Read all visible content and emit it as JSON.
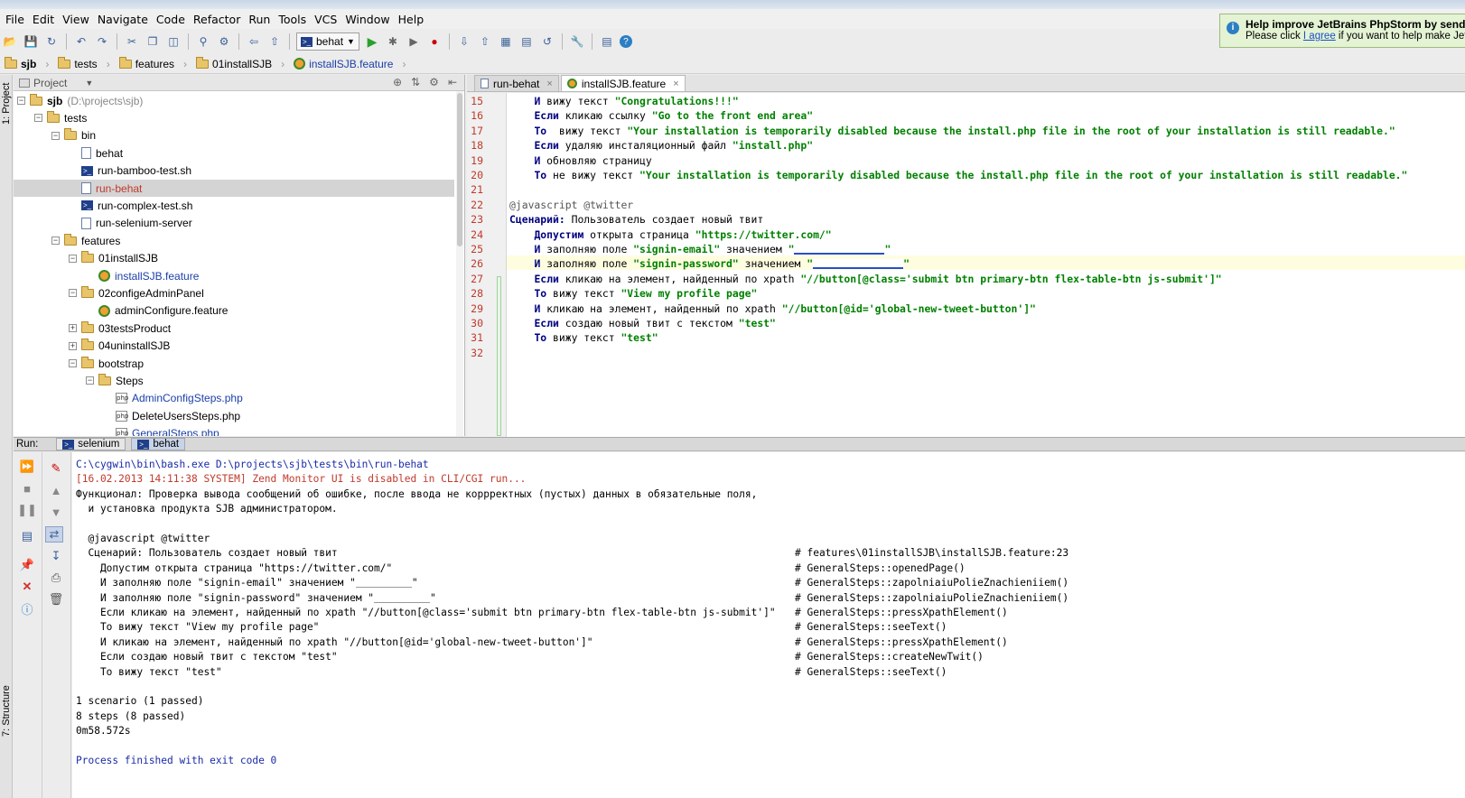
{
  "menu": [
    "File",
    "Edit",
    "View",
    "Navigate",
    "Code",
    "Refactor",
    "Run",
    "Tools",
    "VCS",
    "Window",
    "Help"
  ],
  "toolbar": {
    "run_config": "behat",
    "icons": [
      "open-icon",
      "save-icon",
      "sync-icon",
      "undo-icon",
      "redo-icon",
      "cut-icon",
      "copy-icon",
      "paste-icon",
      "find-icon",
      "replace-icon",
      "back-icon",
      "forward-icon",
      "run-icon",
      "debug-icon",
      "coverage-icon",
      "stop-icon",
      "settings-icon",
      "help-icon"
    ]
  },
  "notification": {
    "title": "Help improve JetBrains PhpStorm by sendin",
    "body_prefix": "Please click ",
    "link": "I agree",
    "body_suffix": " if you want to help make JetBra"
  },
  "breadcrumbs": [
    "sjb",
    "tests",
    "features",
    "01installSJB",
    "installSJB.feature"
  ],
  "left_strip": {
    "project": "1: Project",
    "structure": "7: Structure"
  },
  "project_panel": {
    "title": "Project",
    "tree": [
      {
        "label": "sjb",
        "extra": "(D:\\projects\\sjb)",
        "type": "folder",
        "depth": 0
      },
      {
        "label": "tests",
        "type": "folder",
        "depth": 1
      },
      {
        "label": "bin",
        "type": "folder",
        "depth": 2
      },
      {
        "label": "behat",
        "type": "file",
        "depth": 3
      },
      {
        "label": "run-bamboo-test.sh",
        "type": "sh",
        "depth": 3
      },
      {
        "label": "run-behat",
        "type": "file",
        "depth": 3,
        "selected": true
      },
      {
        "label": "run-complex-test.sh",
        "type": "sh",
        "depth": 3
      },
      {
        "label": "run-selenium-server",
        "type": "file",
        "depth": 3
      },
      {
        "label": "features",
        "type": "folder",
        "depth": 2
      },
      {
        "label": "01installSJB",
        "type": "folder",
        "depth": 3
      },
      {
        "label": "installSJB.feature",
        "type": "feature",
        "depth": 4
      },
      {
        "label": "02configeAdminPanel",
        "type": "folder",
        "depth": 3
      },
      {
        "label": "adminConfigure.feature",
        "type": "feature",
        "depth": 4
      },
      {
        "label": "03testsProduct",
        "type": "folder",
        "depth": 3
      },
      {
        "label": "04uninstallSJB",
        "type": "folder",
        "depth": 3
      },
      {
        "label": "bootstrap",
        "type": "folder",
        "depth": 3
      },
      {
        "label": "Steps",
        "type": "folder",
        "depth": 4
      },
      {
        "label": "AdminConfigSteps.php",
        "type": "php",
        "depth": 5
      },
      {
        "label": "DeleteUsersSteps.php",
        "type": "php",
        "depth": 5
      },
      {
        "label": "GeneralSteps.php",
        "type": "php",
        "depth": 5
      }
    ]
  },
  "editor_tabs": [
    {
      "label": "run-behat",
      "active": false
    },
    {
      "label": "installSJB.feature",
      "active": true
    }
  ],
  "editor_lines": [
    {
      "n": "15",
      "text": "    И вижу текст \"Congratulations!!!\""
    },
    {
      "n": "16",
      "text": "    Если кликаю ссылку \"Go to the front end area\""
    },
    {
      "n": "17",
      "text": "    То  вижу текст \"Your installation is temporarily disabled because the install.php file in the root of your installation is still readable.\""
    },
    {
      "n": "18",
      "text": "    Если удаляю инсталяционный файл \"install.php\""
    },
    {
      "n": "19",
      "text": "    И обновляю страницу"
    },
    {
      "n": "20",
      "text": "    То не вижу текст \"Your installation is temporarily disabled because the install.php file in the root of your installation is still readable.\""
    },
    {
      "n": "21",
      "text": ""
    },
    {
      "n": "22",
      "text": "@javascript @twitter"
    },
    {
      "n": "23",
      "text": "Сценарий: Пользователь создает новый твит"
    },
    {
      "n": "24",
      "text": "    Допустим открыта страница \"https://twitter.com/\""
    },
    {
      "n": "25",
      "text": "    И заполняю поле \"signin-email\" значением \""
    },
    {
      "n": "26",
      "text": "    И заполняю поле \"signin-password\" значением \""
    },
    {
      "n": "27",
      "text": "    Если кликаю на элемент, найденный по xpath \"//button[@class='submit btn primary-btn flex-table-btn js-submit']\""
    },
    {
      "n": "28",
      "text": "    То вижу текст \"View my profile page\""
    },
    {
      "n": "29",
      "text": "    И кликаю на элемент, найденный по xpath \"//button[@id='global-new-tweet-button']\""
    },
    {
      "n": "30",
      "text": "    Если создаю новый твит с текстом \"test\""
    },
    {
      "n": "31",
      "text": "    То вижу текст \"test\""
    },
    {
      "n": "32",
      "text": ""
    }
  ],
  "run_panel": {
    "label": "Run:",
    "tabs": [
      "selenium",
      "behat"
    ],
    "console": [
      "C:\\cygwin\\bin\\bash.exe D:\\projects\\sjb\\tests\\bin\\run-behat",
      "[16.02.2013 14:11:38 SYSTEM] Zend Monitor UI is disabled in CLI/CGI run...",
      "Функционал: Проверка вывода сообщений об ошибке, после ввода не коррректных (пустых) данных в обязательные поля,",
      "  и установка продукта SJB администратором.",
      "",
      "  @javascript @twitter",
      "  Сценарий: Пользователь создает новый твит",
      "    Допустим открыта страница \"https://twitter.com/\"",
      "    И заполняю поле \"signin-email\" значением \"",
      "    И заполняю поле \"signin-password\" значением \"",
      "    Если кликаю на элемент, найденный по xpath \"//button[@class='submit btn primary-btn flex-table-btn js-submit']\"",
      "    То вижу текст \"View my profile page\"",
      "    И кликаю на элемент, найденный по xpath \"//button[@id='global-new-tweet-button']\"",
      "    Если создаю новый твит с текстом \"test\"",
      "    То вижу текст \"test\"",
      "",
      "1 scenario (1 passed)",
      "8 steps (8 passed)",
      "0m58.572s",
      "",
      "Process finished with exit code 0"
    ],
    "comments": [
      "# features\\01installSJB\\installSJB.feature:23",
      "# GeneralSteps::openedPage()",
      "# GeneralSteps::zapolniaiuPolieZnachieniiem()",
      "# GeneralSteps::zapolniaiuPolieZnachieniiem()",
      "# GeneralSteps::pressXpathElement()",
      "# GeneralSteps::seeText()",
      "# GeneralSteps::pressXpathElement()",
      "# GeneralSteps::createNewTwit()",
      "# GeneralSteps::seeText()"
    ]
  },
  "colors": {
    "keyword": "#000080",
    "string": "#008000",
    "line_number": "#c0392b",
    "console_blue": "#1a2aa8",
    "console_red": "#c0392b"
  }
}
